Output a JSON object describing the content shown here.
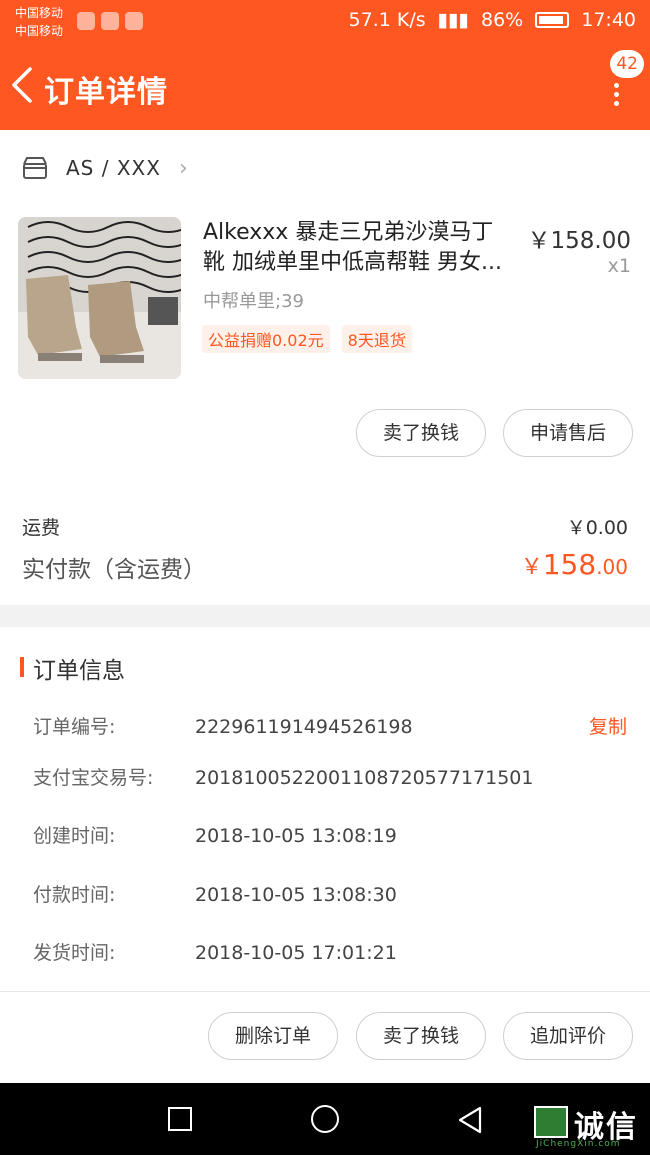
{
  "status_bar": {
    "carrier1": "中国移动",
    "carrier2": "中国移动",
    "network_speed": "57.1 K/s",
    "battery_percent": "86%",
    "time": "17:40"
  },
  "nav": {
    "title": "订单详情",
    "badge_count": "42"
  },
  "store": {
    "name": "AS / XXX"
  },
  "product": {
    "title": "Alkexxx 暴走三兄弟沙漠马丁靴 加绒单里中低高帮鞋 男女...",
    "price": "￥158.00",
    "quantity": "x1",
    "spec": "中帮单里;39",
    "tags": [
      "公益捐赠0.02元",
      "8天退货"
    ]
  },
  "item_actions": {
    "sell_label": "卖了换钱",
    "aftersale_label": "申请售后"
  },
  "summary": {
    "freight_label": "运费",
    "freight_value": "￥0.00",
    "paid_label": "实付款（含运费）",
    "paid_currency": "￥",
    "paid_integer": "158",
    "paid_decimal": ".00"
  },
  "order_info": {
    "title": "订单信息",
    "copy_label": "复制",
    "rows": [
      {
        "label": "订单编号:",
        "value": "222961191494526198"
      },
      {
        "label": "支付宝交易号:",
        "value": "2018100522001108720577171501"
      },
      {
        "label": "创建时间:",
        "value": "2018-10-05 13:08:19"
      },
      {
        "label": "付款时间:",
        "value": "2018-10-05 13:08:30"
      },
      {
        "label": "发货时间:",
        "value": "2018-10-05 17:01:21"
      }
    ]
  },
  "footer_actions": {
    "delete_label": "删除订单",
    "sell_label": "卖了换钱",
    "review_label": "追加评价"
  },
  "watermark": {
    "text": "诚信",
    "url": "JiChengXin.com"
  },
  "colors": {
    "accent": "#ff5722",
    "tag_bg": "#fff1ea"
  }
}
